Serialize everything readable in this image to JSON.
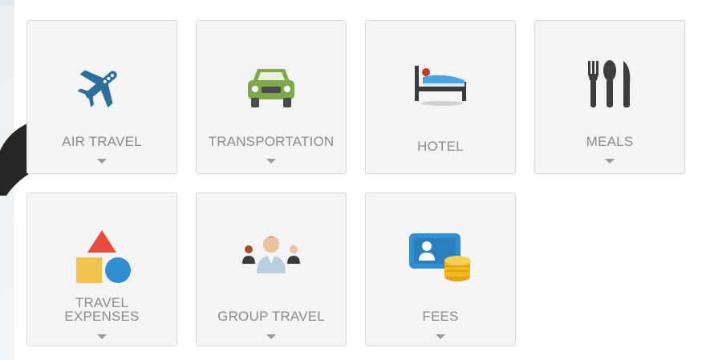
{
  "tiles": [
    {
      "label": "AIR TRAVEL",
      "icon": "airplane-icon",
      "has_dropdown": true
    },
    {
      "label": "TRANSPORTATION",
      "icon": "car-icon",
      "has_dropdown": true
    },
    {
      "label": "HOTEL",
      "icon": "hotel-bed-icon",
      "has_dropdown": false
    },
    {
      "label": "MEALS",
      "icon": "fork-knife-spoon-icon",
      "has_dropdown": true
    },
    {
      "label_line1": "TRAVEL",
      "label_line2": "EXPENSES",
      "icon": "shapes-icon",
      "has_dropdown": true
    },
    {
      "label": "GROUP TRAVEL",
      "icon": "group-people-icon",
      "has_dropdown": true
    },
    {
      "label": "FEES",
      "icon": "id-card-coins-icon",
      "has_dropdown": true
    }
  ],
  "colors": {
    "tile_bg": "#f4f4f4",
    "label": "#8c8c8c",
    "airplane": "#2c6f9a",
    "car": "#7ea84a",
    "hotel_blanket": "#4aa3df",
    "meals": "#3d3d3d",
    "triangle": "#e74c3c",
    "square": "#f2c14e",
    "circle": "#2f8fd1",
    "fees_card": "#2f8fd1",
    "coins": "#f2b81c"
  }
}
